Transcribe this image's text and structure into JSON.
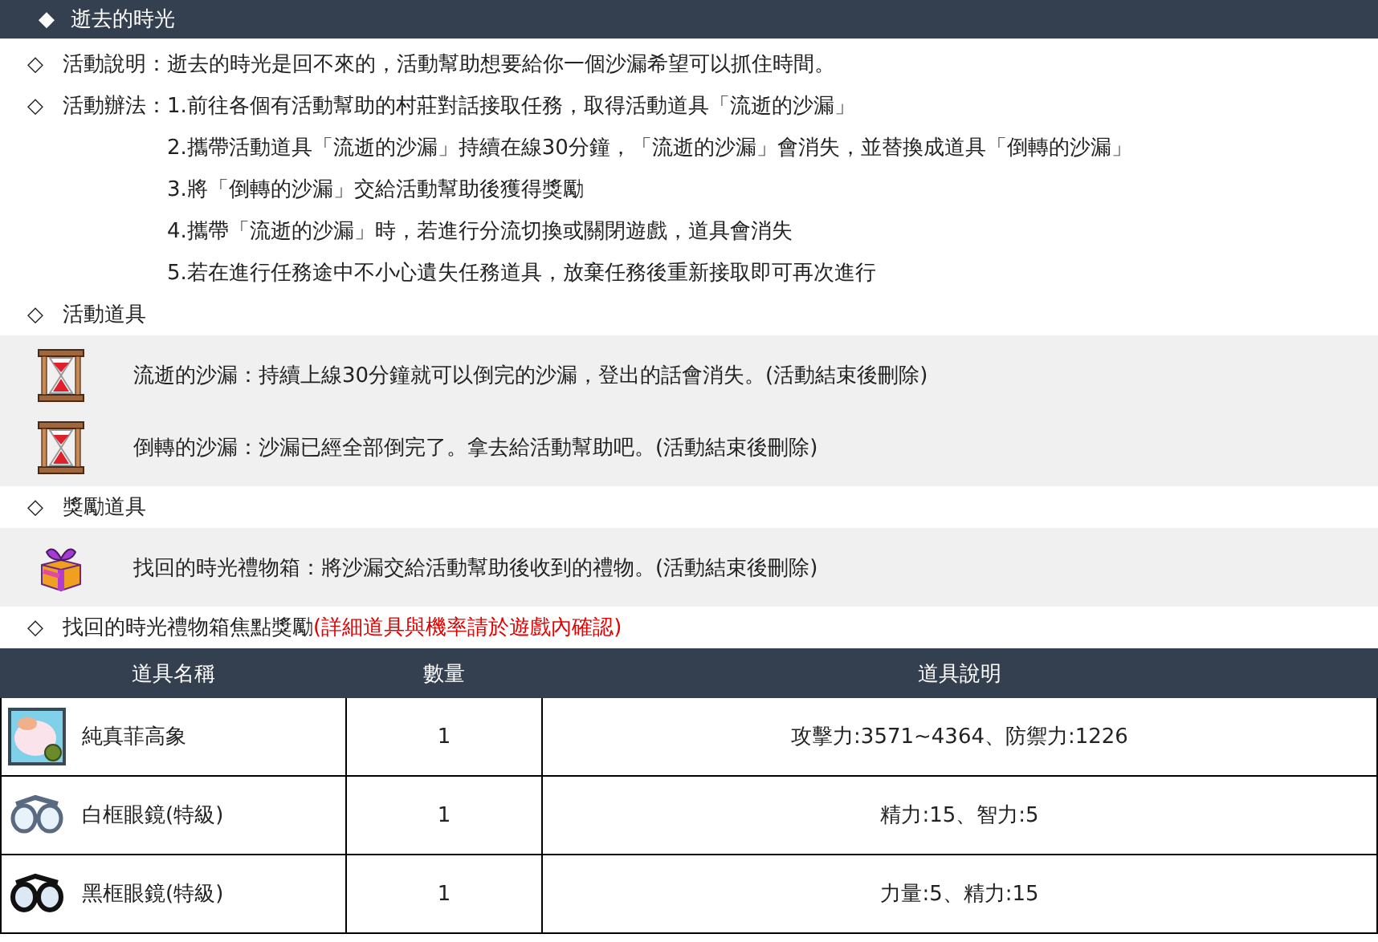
{
  "header": {
    "marker": "◆",
    "title": "逝去的時光"
  },
  "sections": [
    {
      "kind": "text",
      "marker": "◇",
      "label": "活動說明：",
      "lines": [
        "逝去的時光是回不來的，活動幫助想要給你一個沙漏希望可以抓住時間。"
      ]
    },
    {
      "kind": "steps",
      "marker": "◇",
      "label": "活動辦法：",
      "lines": [
        "1.前往各個有活動幫助的村莊對話接取任務，取得活動道具「流逝的沙漏」",
        "2.攜帶活動道具「流逝的沙漏」持續在線30分鐘，「流逝的沙漏」會消失，並替換成道具「倒轉的沙漏」",
        "3.將「倒轉的沙漏」交給活動幫助後獲得獎勵",
        "4.攜帶「流逝的沙漏」時，若進行分流切換或關閉遊戲，道具會消失",
        "5.若在進行任務途中不小心遺失任務道具，放棄任務後重新接取即可再次進行"
      ]
    },
    {
      "kind": "items",
      "marker": "◇",
      "label": "活動道具",
      "items": [
        {
          "kind": "hourglass",
          "text": "流逝的沙漏：持續上線30分鐘就可以倒完的沙漏，登出的話會消失。(活動結束後刪除)"
        },
        {
          "kind": "hourglass",
          "text": "倒轉的沙漏：沙漏已經全部倒完了。拿去給活動幫助吧。(活動結束後刪除)"
        }
      ]
    },
    {
      "kind": "items",
      "marker": "◇",
      "label": "獎勵道具",
      "items": [
        {
          "kind": "gift",
          "text": "找回的時光禮物箱：將沙漏交給活動幫助後收到的禮物。(活動結束後刪除)"
        }
      ]
    },
    {
      "kind": "heading",
      "marker": "◇",
      "label": "找回的時光禮物箱焦點獎勵",
      "note": "(詳細道具與機率請於遊戲內確認)"
    }
  ],
  "table": {
    "columns": [
      "道具名稱",
      "數量",
      "道具說明"
    ],
    "rows": [
      {
        "kind": "pet",
        "name": "純真菲高象",
        "count": "1",
        "description": "攻擊力:3571~4364、防禦力:1226"
      },
      {
        "kind": "white-glasses",
        "name": "白框眼鏡(特級)",
        "count": "1",
        "description": "精力:15、智力:5"
      },
      {
        "kind": "black-glasses",
        "name": "黑框眼鏡(特級)",
        "count": "1",
        "description": "力量:5、精力:15"
      }
    ]
  }
}
